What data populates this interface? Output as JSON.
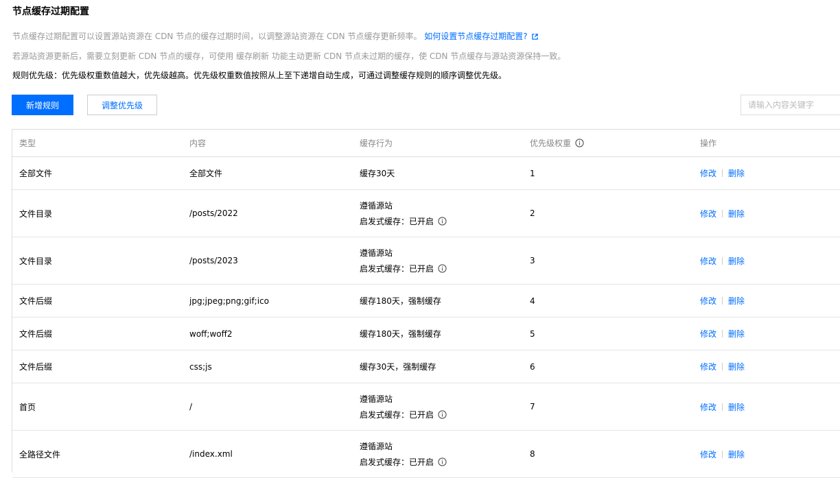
{
  "page": {
    "title": "节点缓存过期配置",
    "desc1": "节点缓存过期配置可以设置源站资源在 CDN 节点的缓存过期时间，以调整源站资源在 CDN 节点缓存更新频率。",
    "desc1_link": "如何设置节点缓存过期配置?",
    "desc2": "若源站资源更新后，需要立刻更新 CDN 节点的缓存，可使用 缓存刷新 功能主动更新 CDN 节点未过期的缓存，使 CDN 节点缓存与源站资源保持一致。",
    "desc3": "规则优先级：优先级权重数值越大，优先级越高。优先级权重数值按照从上至下递增自动生成，可通过调整缓存规则的顺序调整优先级。"
  },
  "toolbar": {
    "add_label": "新增规则",
    "priority_label": "调整优先级",
    "search_placeholder": "请输入内容关键字"
  },
  "table": {
    "headers": [
      "类型",
      "内容",
      "缓存行为",
      "优先级权重",
      "操作"
    ],
    "rows": [
      {
        "type": "全部文件",
        "content": "全部文件",
        "behavior": "缓存30天",
        "sub": "",
        "weight": "1",
        "edit": "修改",
        "del": "删除"
      },
      {
        "type": "文件目录",
        "content": "/posts/2022",
        "behavior": "遵循源站",
        "sub": "启发式缓存：已开启",
        "weight": "2",
        "edit": "修改",
        "del": "删除"
      },
      {
        "type": "文件目录",
        "content": "/posts/2023",
        "behavior": "遵循源站",
        "sub": "启发式缓存：已开启",
        "weight": "3",
        "edit": "修改",
        "del": "删除"
      },
      {
        "type": "文件后缀",
        "content": "jpg;jpeg;png;gif;ico",
        "behavior": "缓存180天，强制缓存",
        "sub": "",
        "weight": "4",
        "edit": "修改",
        "del": "删除"
      },
      {
        "type": "文件后缀",
        "content": "woff;woff2",
        "behavior": "缓存180天，强制缓存",
        "sub": "",
        "weight": "5",
        "edit": "修改",
        "del": "删除"
      },
      {
        "type": "文件后缀",
        "content": "css;js",
        "behavior": "缓存30天，强制缓存",
        "sub": "",
        "weight": "6",
        "edit": "修改",
        "del": "删除"
      },
      {
        "type": "首页",
        "content": "/",
        "behavior": "遵循源站",
        "sub": "启发式缓存：已开启",
        "weight": "7",
        "edit": "修改",
        "del": "删除"
      },
      {
        "type": "全路径文件",
        "content": "/index.xml",
        "behavior": "遵循源站",
        "sub": "启发式缓存：已开启",
        "weight": "8",
        "edit": "修改",
        "del": "删除"
      }
    ]
  },
  "colors": {
    "accent": "#006eff",
    "muted": "#999999"
  },
  "icons": {
    "external_link": "external-link-icon",
    "info": "info-icon"
  }
}
